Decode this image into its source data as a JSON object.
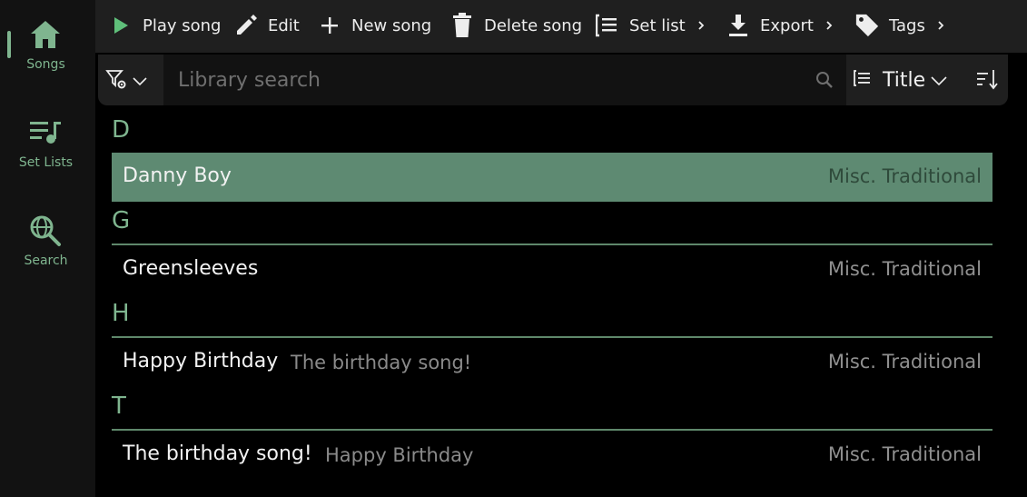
{
  "nav": {
    "items": [
      {
        "label": "Songs",
        "icon": "home-icon",
        "active": true
      },
      {
        "label": "Set Lists",
        "icon": "playlist-music-icon",
        "active": false
      },
      {
        "label": "Search",
        "icon": "globe-search-icon",
        "active": false
      }
    ]
  },
  "toolbar": {
    "play_label": "Play song",
    "edit_label": "Edit",
    "new_label": "New song",
    "delete_label": "Delete song",
    "setlist_label": "Set list",
    "export_label": "Export",
    "tags_label": "Tags"
  },
  "filter": {
    "search_placeholder": "Library search",
    "search_value": "",
    "sort_field": "Title"
  },
  "colors": {
    "accent": "#7fb58f",
    "selected_row": "#5e8a72",
    "play_icon": "#5fbf7a"
  },
  "groups": [
    {
      "letter": "D",
      "songs": [
        {
          "title": "Danny Boy",
          "alt": "",
          "artist": "Misc. Traditional",
          "selected": true
        }
      ]
    },
    {
      "letter": "G",
      "songs": [
        {
          "title": "Greensleeves",
          "alt": "",
          "artist": "Misc. Traditional",
          "selected": false
        }
      ]
    },
    {
      "letter": "H",
      "songs": [
        {
          "title": "Happy Birthday",
          "alt": "The birthday song!",
          "artist": "Misc. Traditional",
          "selected": false
        }
      ]
    },
    {
      "letter": "T",
      "songs": [
        {
          "title": "The birthday song!",
          "alt": "Happy Birthday",
          "artist": "Misc. Traditional",
          "selected": false
        }
      ]
    }
  ]
}
